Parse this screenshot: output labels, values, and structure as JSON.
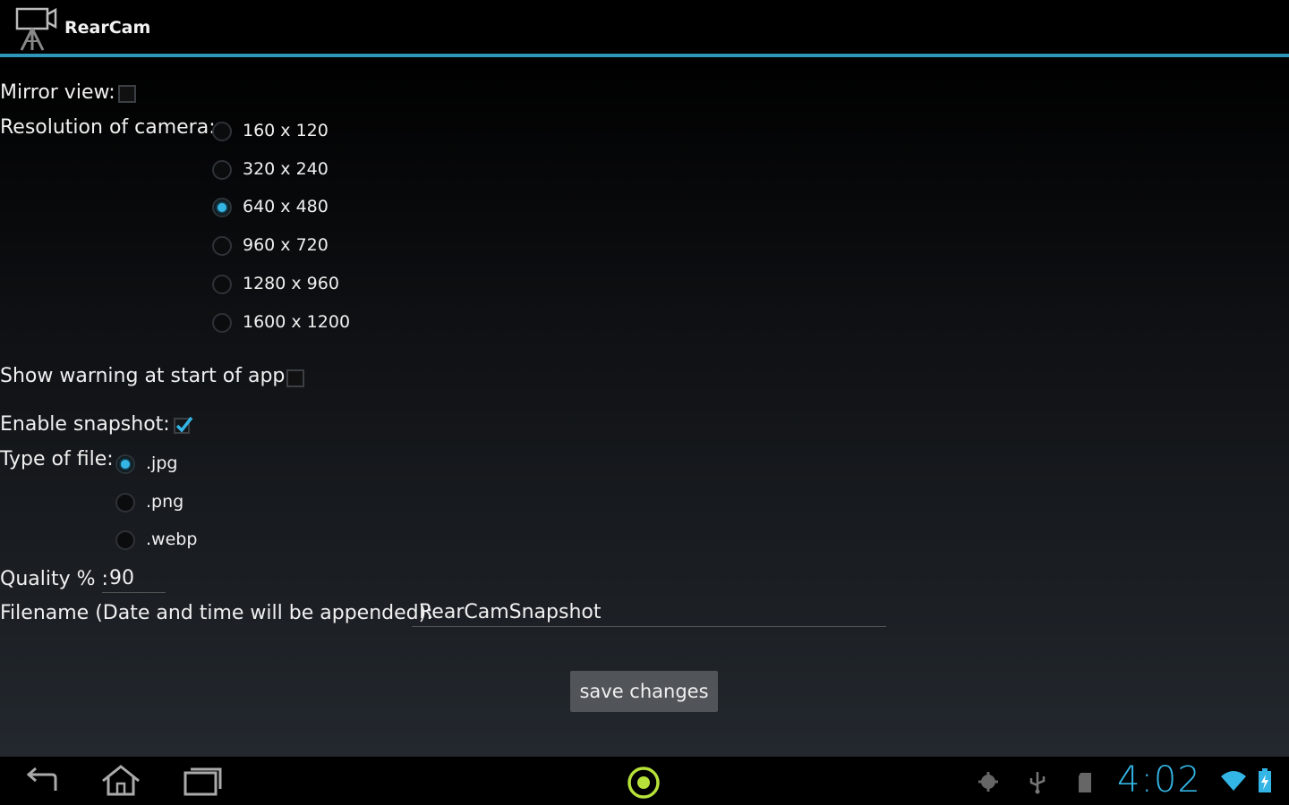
{
  "app": {
    "title": "RearCam"
  },
  "settings": {
    "mirror_label": "Mirror view:",
    "mirror_checked": false,
    "resolution_label": "Resolution of camera:",
    "resolutions": [
      "160 x 120",
      "320 x 240",
      "640 x 480",
      "960 x 720",
      "1280 x 960",
      "1600 x 1200"
    ],
    "resolution_selected": "640 x 480",
    "warning_label": "Show warning at start of app:",
    "warning_checked": false,
    "snapshot_label": "Enable snapshot:",
    "snapshot_checked": true,
    "filetype_label": "Type of file:",
    "filetypes": [
      ".jpg",
      ".png",
      ".webp"
    ],
    "filetype_selected": ".jpg",
    "quality_label": "Quality % :",
    "quality_value": "90",
    "filename_label": "Filename (Date and time will be appended):",
    "filename_value": "RearCamSnapshot",
    "save_label": "save changes"
  },
  "system_bar": {
    "clock": "4:02",
    "accent": "#33b5e5",
    "icons": [
      "back-icon",
      "home-icon",
      "recent-apps-icon",
      "camera-shortcut-icon",
      "android-debug-icon",
      "usb-icon",
      "sd-card-icon",
      "wifi-icon",
      "battery-icon"
    ]
  }
}
